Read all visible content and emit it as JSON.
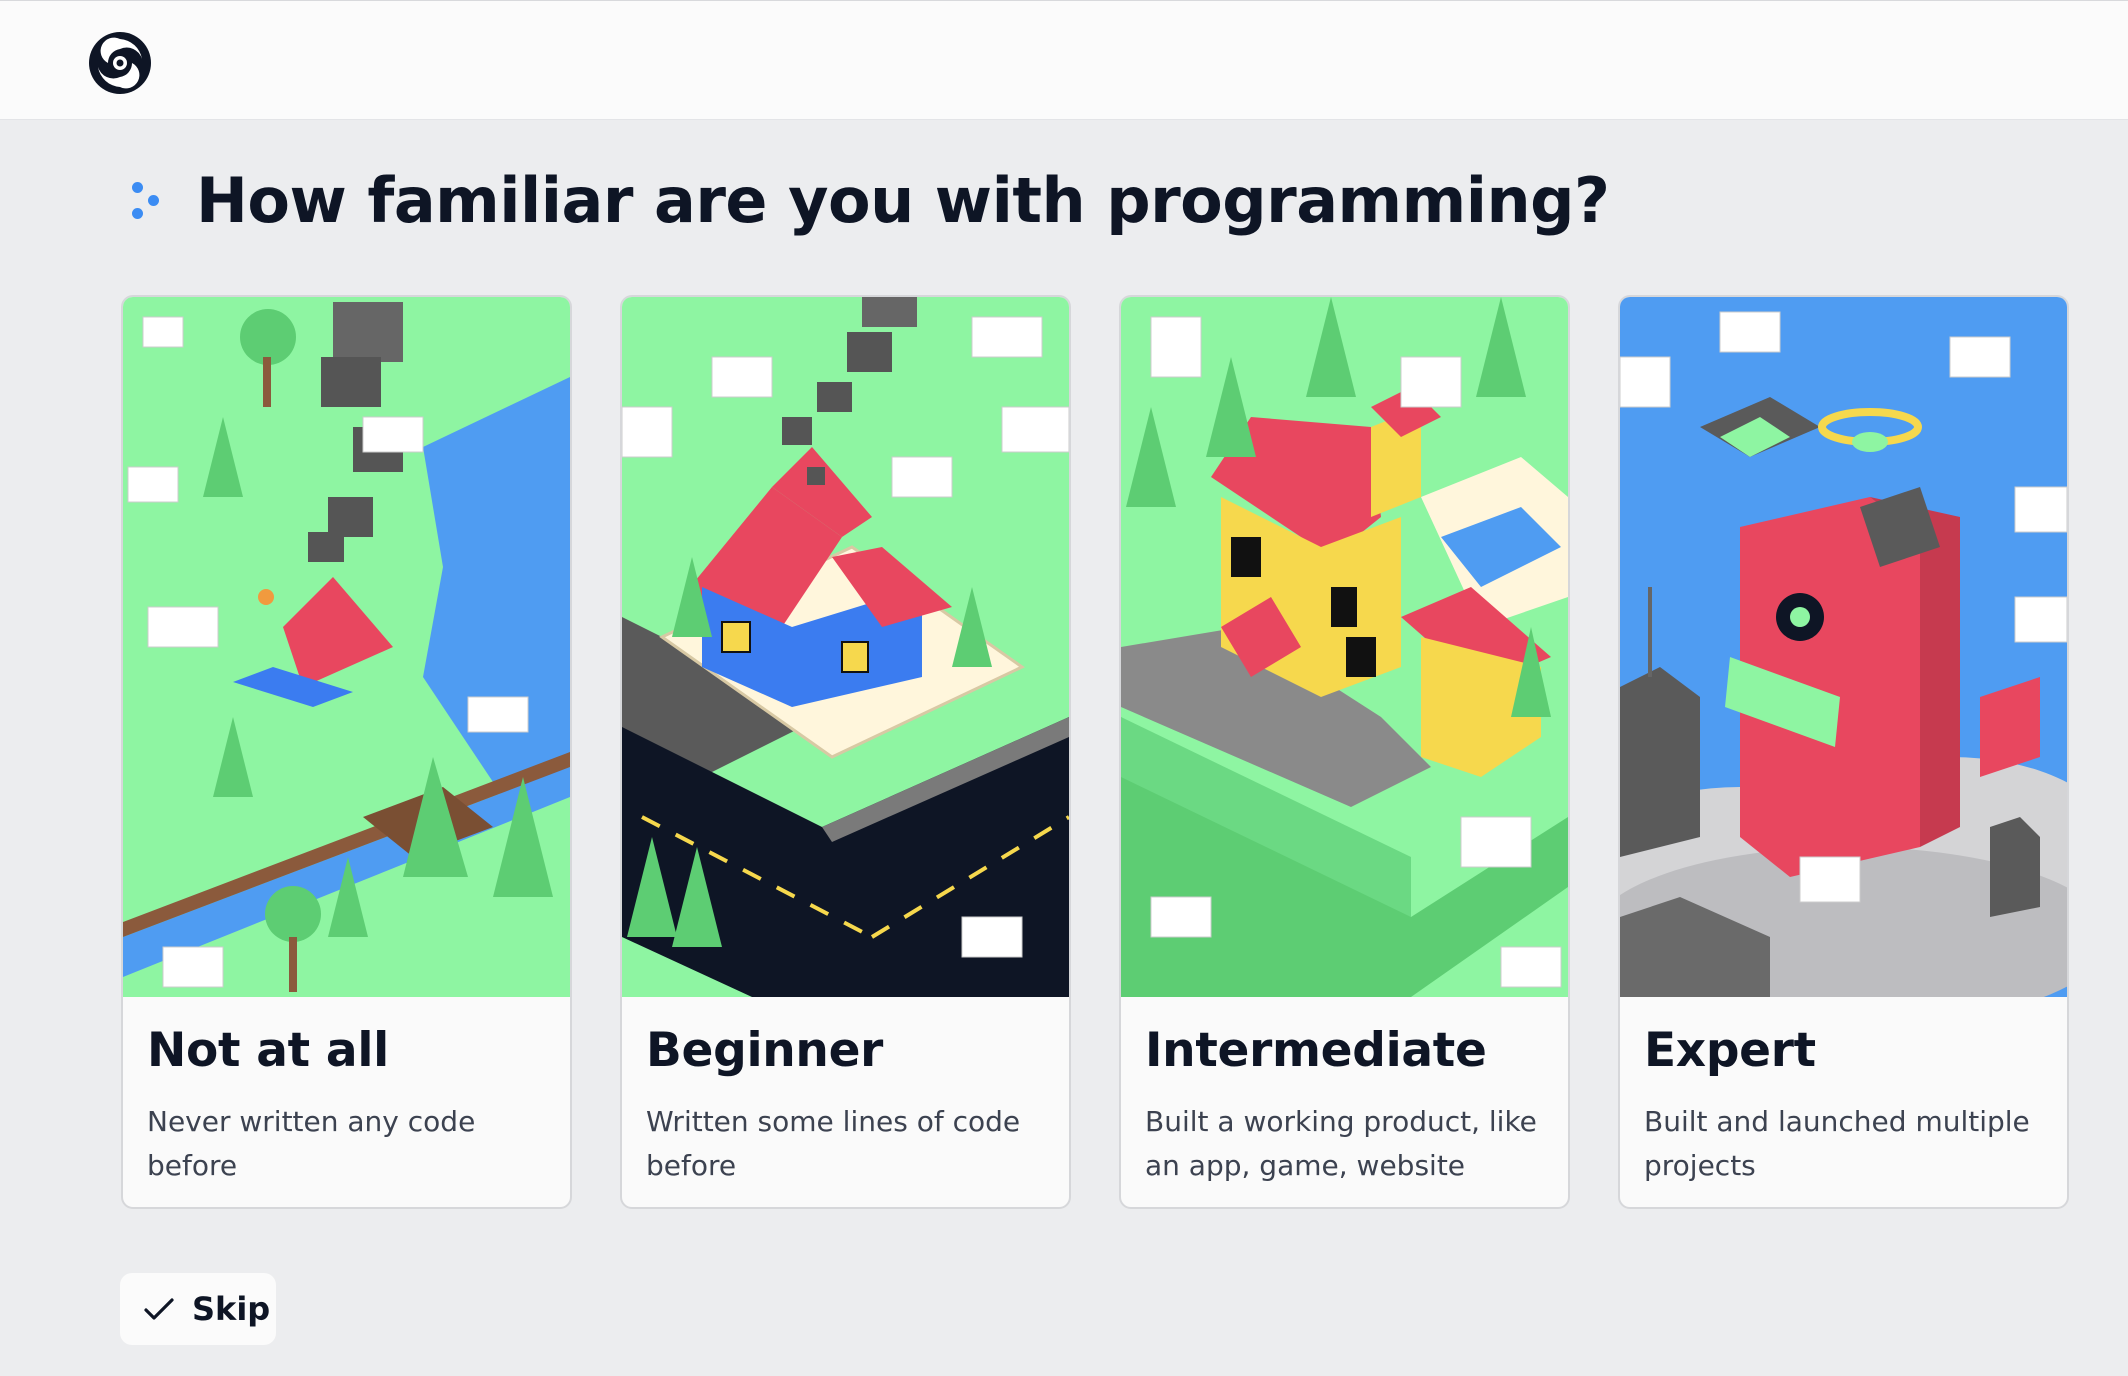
{
  "header": {
    "logo_icon": "replit-logo-icon"
  },
  "question": {
    "title": "How familiar are you with programming?",
    "bullet_color": "#3b8cf3"
  },
  "options": [
    {
      "title": "Not at all",
      "description": "Never written any code before",
      "illustration": "campsite-illustration"
    },
    {
      "title": "Beginner",
      "description": "Written some lines of code before",
      "illustration": "house-illustration"
    },
    {
      "title": "Intermediate",
      "description": "Built a working product, like an app, game, website",
      "illustration": "mansion-illustration"
    },
    {
      "title": "Expert",
      "description": "Built and launched multiple projects",
      "illustration": "skyscraper-illustration"
    }
  ],
  "skip": {
    "label": "Skip",
    "icon": "check-icon"
  },
  "colors": {
    "grass": "#8ef5a2",
    "red": "#e8475f",
    "sky": "#4f9cf2",
    "yellow": "#f6d84d"
  }
}
